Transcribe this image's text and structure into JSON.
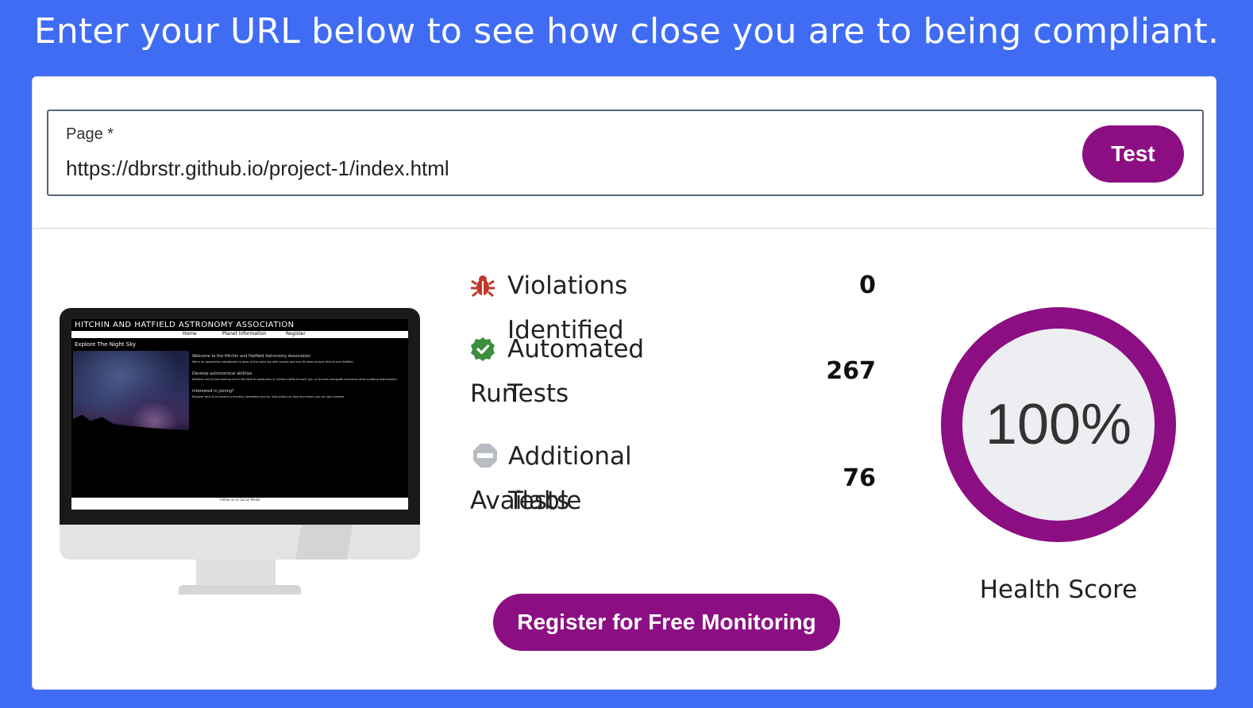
{
  "headline": "Enter your URL below to see how close you are to being compliant.",
  "form": {
    "page_label": "Page *",
    "page_value": "https://dbrstr.github.io/project-1/index.html",
    "test_label": "Test"
  },
  "preview": {
    "site_title": "HITCHIN AND HATFIELD ASTRONOMY ASSOCIATION",
    "nav": [
      "Home",
      "Planet Information",
      "Register"
    ],
    "subtitle": "Explore The Night Sky",
    "paragraphs": [
      "Welcome to the Hitchin and Hatfield Astronomy Association",
      "We're an association established to gaze at the night sky with scopes and lens fit areas around Hitchin and Hatfield",
      "Develop astronomical abilities",
      "Whether you're just starting out in the field of astronomy or Galileo Galilei himself, join us to learn alongside and teach other budding astronomers",
      "Interested in joining?",
      "Register with us to receive a monthly newsletter and for instructions on how and where you can get involved."
    ],
    "footer": "Follow us on Social Media"
  },
  "stats": {
    "violations": {
      "label": "Violations Identified",
      "value": "0",
      "icon": "bug-icon",
      "color": "#c0392b"
    },
    "automated": {
      "label_line1": "Automated Tests",
      "label_line2": "Run",
      "value": "267",
      "icon": "check-badge-icon",
      "color": "#3c8d3f"
    },
    "additional": {
      "label_line1": "Additional Tests",
      "label_line2": "Available",
      "value": "76",
      "icon": "minus-badge-icon",
      "color": "#b9bcc2"
    }
  },
  "register_label": "Register for Free Monitoring",
  "health": {
    "score": "100%",
    "score_fraction": 1.0,
    "caption": "Health Score",
    "color": "#8b0f82"
  }
}
